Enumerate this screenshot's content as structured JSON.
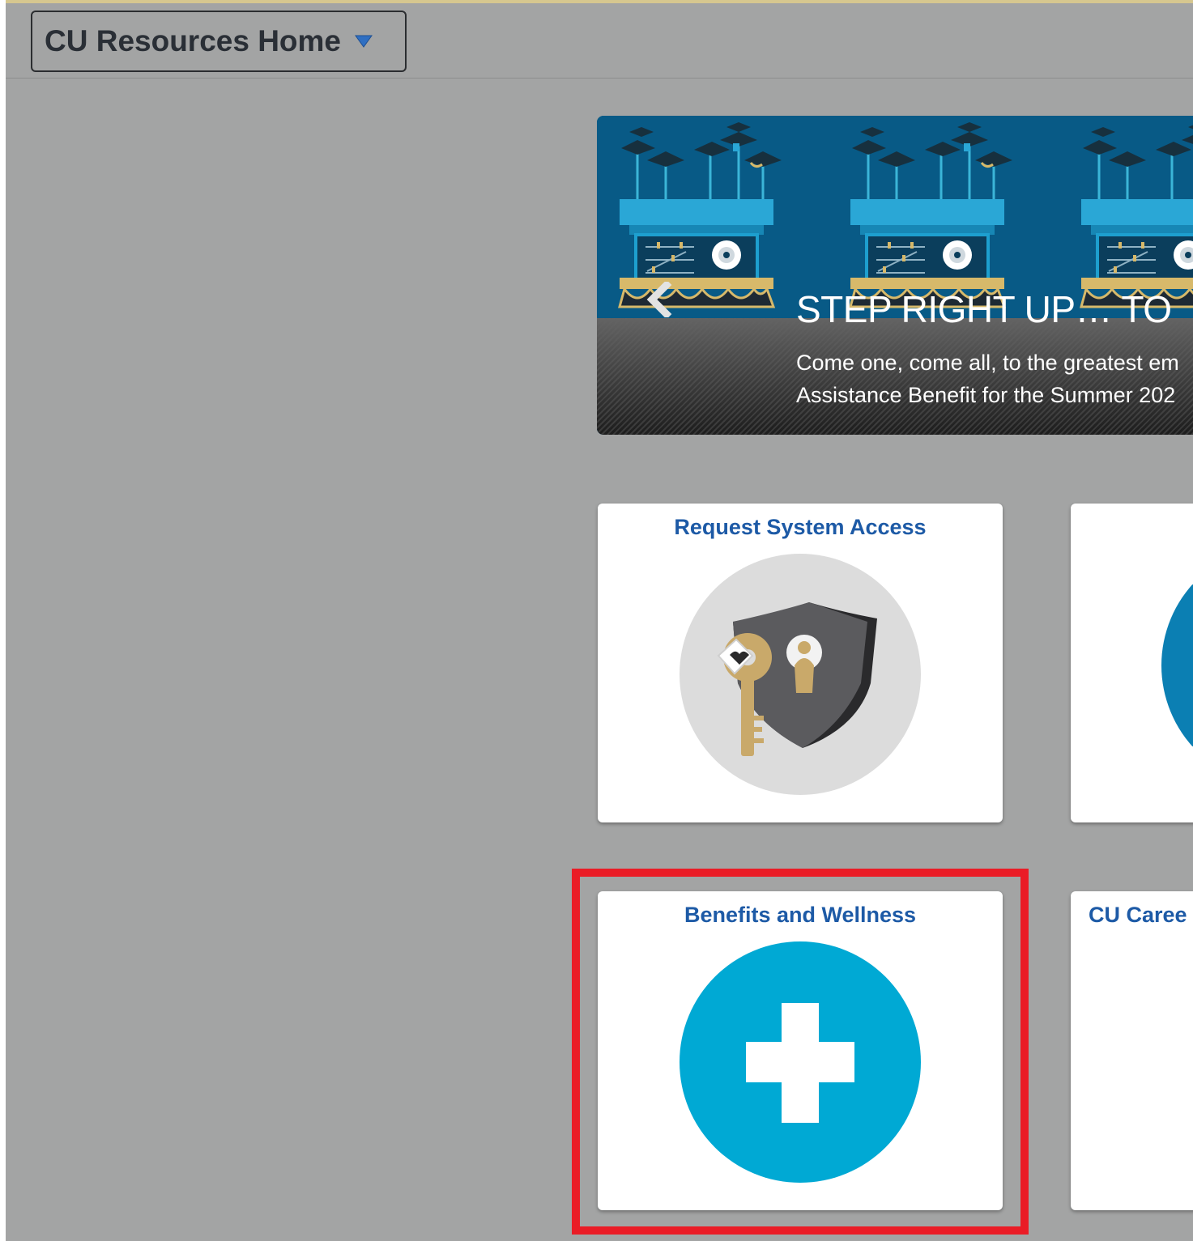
{
  "header": {
    "homepage_title": "CU Resources Home"
  },
  "banner": {
    "heading": "STEP RIGHT UP… TO",
    "text_line1": "Come one, come all, to the greatest em",
    "text_line2": "Assistance Benefit for the Summer 202"
  },
  "tiles": [
    {
      "title": "Request System Access",
      "icon": "shield-key-icon"
    },
    {
      "title": "",
      "icon": "blue-circle-icon"
    },
    {
      "title": "Benefits and Wellness",
      "icon": "medical-cross-icon",
      "highlighted": true
    },
    {
      "title": "CU Caree",
      "icon": ""
    }
  ],
  "colors": {
    "background": "#a3a4a4",
    "tile_title": "#1d5aa6",
    "benefits_circle": "#00a9d4",
    "highlight": "#ea1c26",
    "banner_blue": "#085a86"
  }
}
